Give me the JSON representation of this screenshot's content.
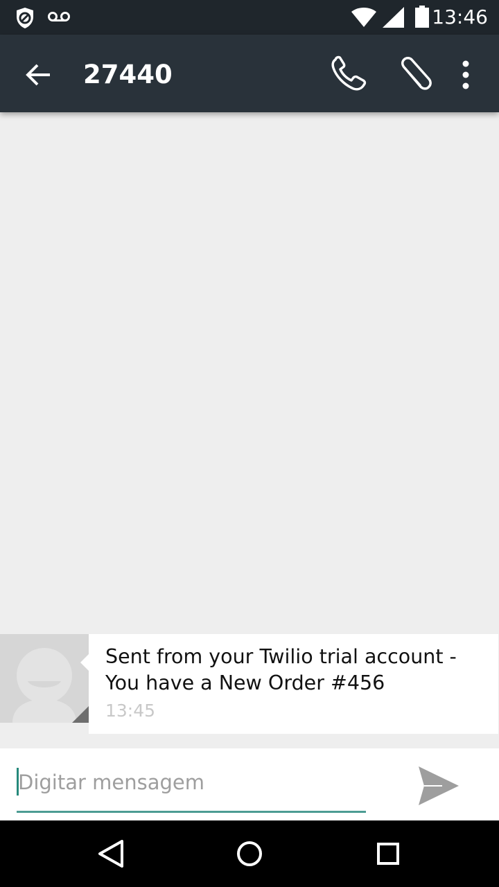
{
  "status_bar": {
    "time": "13:46",
    "icons": [
      "blocked-shield-icon",
      "voicemail-icon",
      "wifi-icon",
      "cellular-signal-icon",
      "battery-icon"
    ]
  },
  "toolbar": {
    "title": "27440",
    "icons": [
      "back-arrow-icon",
      "phone-icon",
      "paperclip-icon",
      "more-vert-icon"
    ]
  },
  "conversation": {
    "messages": [
      {
        "text": "Sent from your Twilio trial account - You have a New Order #456",
        "time": "13:45"
      }
    ]
  },
  "compose": {
    "placeholder": "Digitar mensagem",
    "value": "",
    "send_icon": "send-icon"
  },
  "nav_bar": {
    "icons": [
      "back-triangle-icon",
      "home-circle-icon",
      "recents-square-icon"
    ]
  },
  "colors": {
    "status_bar": "#1f262c",
    "toolbar": "#29323a",
    "background": "#eeeeee",
    "accent": "#26897b"
  }
}
